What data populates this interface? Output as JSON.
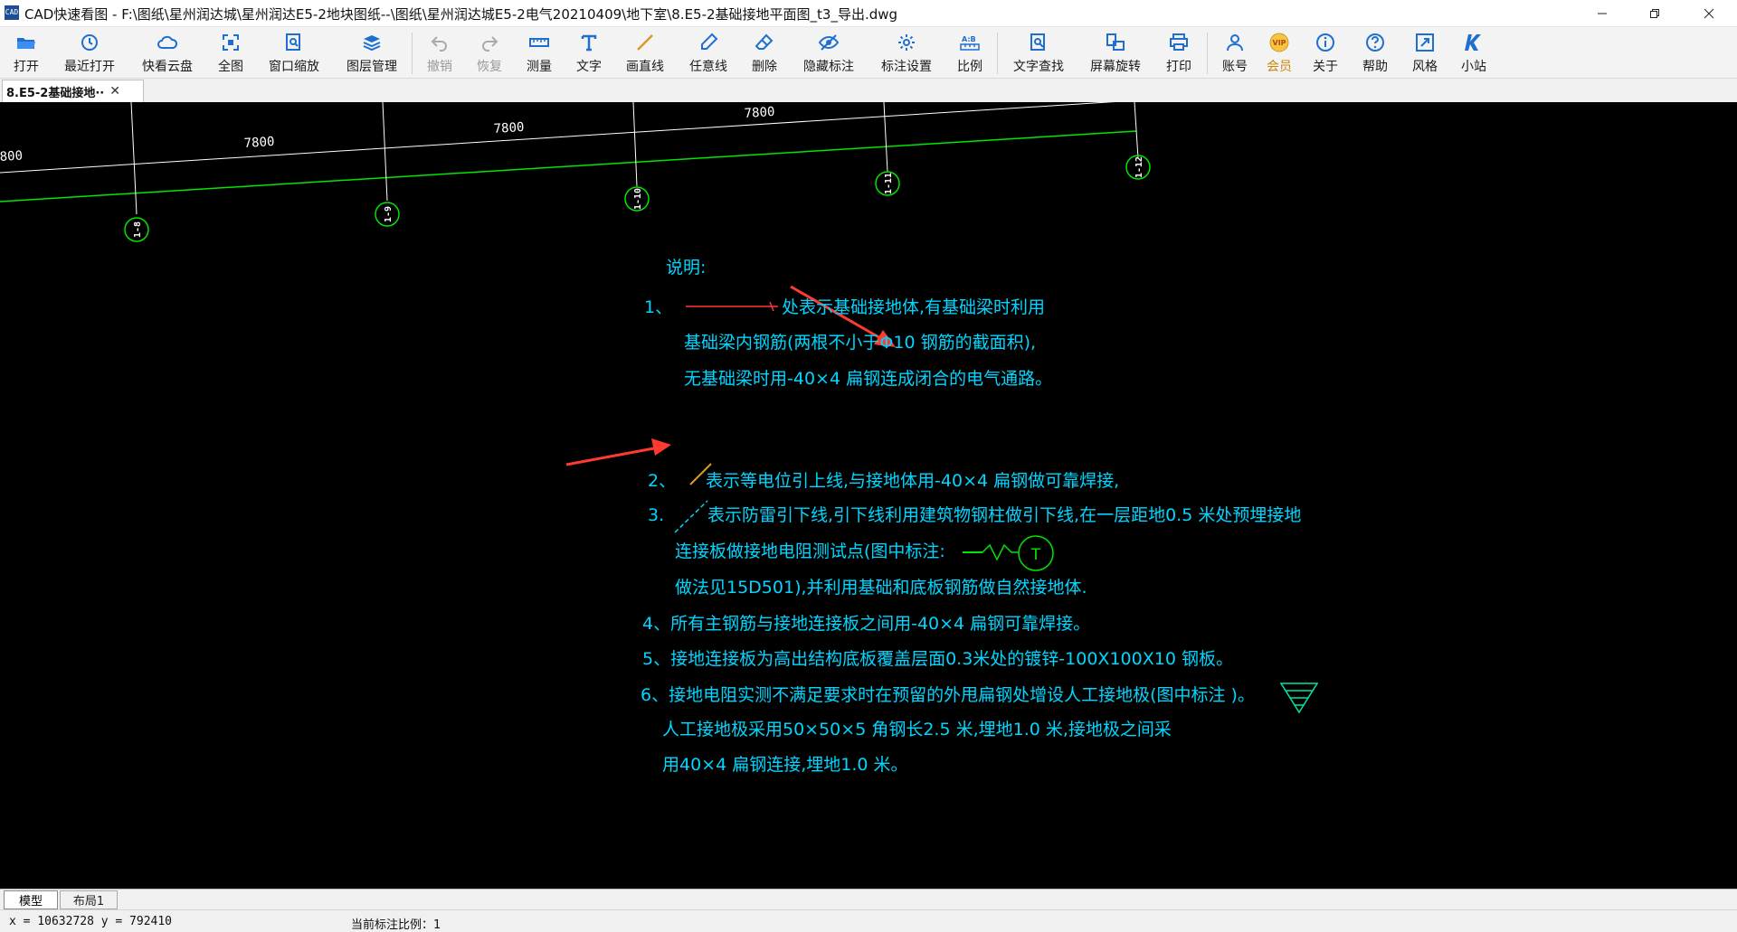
{
  "window": {
    "title": "CAD快速看图 - F:\\图纸\\星州润达城\\星州润达E5-2地块图纸--\\图纸\\星州润达城E5-2电气20210409\\地下室\\8.E5-2基础接地平面图_t3_导出.dwg",
    "app_icon_text": "CAD"
  },
  "toolbar": [
    {
      "label": "打开",
      "icon": "folder-open-icon",
      "enabled": true
    },
    {
      "label": "最近打开",
      "icon": "clock-icon",
      "enabled": true
    },
    {
      "label": "快看云盘",
      "icon": "cloud-icon",
      "enabled": true
    },
    {
      "label": "全图",
      "icon": "fit-all-icon",
      "enabled": true
    },
    {
      "label": "窗口缩放",
      "icon": "zoom-window-icon",
      "enabled": true
    },
    {
      "label": "图层管理",
      "icon": "layers-icon",
      "enabled": true
    },
    {
      "label": "撤销",
      "icon": "undo-icon",
      "enabled": false
    },
    {
      "label": "恢复",
      "icon": "redo-icon",
      "enabled": false
    },
    {
      "label": "测量",
      "icon": "ruler-icon",
      "enabled": true
    },
    {
      "label": "文字",
      "icon": "text-icon",
      "enabled": true
    },
    {
      "label": "画直线",
      "icon": "line-icon",
      "enabled": true
    },
    {
      "label": "任意线",
      "icon": "pen-icon",
      "enabled": true
    },
    {
      "label": "删除",
      "icon": "eraser-icon",
      "enabled": true
    },
    {
      "label": "隐藏标注",
      "icon": "eye-icon",
      "enabled": true
    },
    {
      "label": "标注设置",
      "icon": "gear-icon",
      "enabled": true
    },
    {
      "label": "比例",
      "icon": "scale-icon",
      "enabled": true
    },
    {
      "label": "文字查找",
      "icon": "text-search-icon",
      "enabled": true
    },
    {
      "label": "屏幕旋转",
      "icon": "rotate-screen-icon",
      "enabled": true
    },
    {
      "label": "打印",
      "icon": "printer-icon",
      "enabled": true
    },
    {
      "label": "账号",
      "icon": "user-icon",
      "enabled": true
    },
    {
      "label": "会员",
      "icon": "vip-icon",
      "enabled": true
    },
    {
      "label": "关于",
      "icon": "info-icon",
      "enabled": true
    },
    {
      "label": "帮助",
      "icon": "help-icon",
      "enabled": true
    },
    {
      "label": "风格",
      "icon": "style-icon",
      "enabled": true
    },
    {
      "label": "小站",
      "icon": "k-logo-icon",
      "enabled": true
    }
  ],
  "tabs": {
    "document_tab_label": "8.E5-2基础接地··",
    "close_glyph": "✕"
  },
  "drawing": {
    "dimensions": [
      "800",
      "7800",
      "7800",
      "7800",
      "7800"
    ],
    "axis_labels": [
      "1-8",
      "1-9",
      "1-10",
      "1-11",
      "1-12"
    ],
    "notes": {
      "heading": "说明:",
      "n1_num": "1、",
      "n1_line1": "处表示基础接地体,有基础梁时利用",
      "n1_line2": "基础梁内钢筋(两根不小于Φ10 钢筋的截面积),",
      "n1_line3": "无基础梁时用-40×4 扁钢连成闭合的电气通路。",
      "n2_num": "2、",
      "n2_text": "表示等电位引上线,与接地体用-40×4 扁钢做可靠焊接,",
      "n3_num": "3.",
      "n3_line1": "表示防雷引下线,引下线利用建筑物钢柱做引下线,在一层距地0.5 米处预埋接地",
      "n3_line2": "连接板做接地电阻测试点(图中标注:",
      "n3_line3": "做法见15D501),并利用基础和底板钢筋做自然接地体.",
      "n4": "4、所有主钢筋与接地连接板之间用-40×4 扁钢可靠焊接。",
      "n5": "5、接地连接板为高出结构底板覆盖层面0.3米处的镀锌-100X100X10 钢板。",
      "n6_line1": "6、接地电阻实测不满足要求时在预留的外甩扁钢处增设人工接地极(图中标注      )。",
      "n6_line2": "人工接地极采用50×50×5 角钢长2.5 米,埋地1.0 米,接地极之间采",
      "n6_line3": "用40×4 扁钢连接,埋地1.0 米。",
      "test_point_symbol_text": "T"
    },
    "colors": {
      "background": "#000000",
      "axis_line": "#ffffff",
      "ground_line": "#00e600",
      "note_text": "#00d6ff",
      "arrow": "#ff3b2f",
      "earth_symbol": "#00e6a8"
    }
  },
  "layout_tabs": [
    "模型",
    "布局1"
  ],
  "status": {
    "coords": "x = 10632728  y = 792410",
    "scale": "当前标注比例：1"
  }
}
